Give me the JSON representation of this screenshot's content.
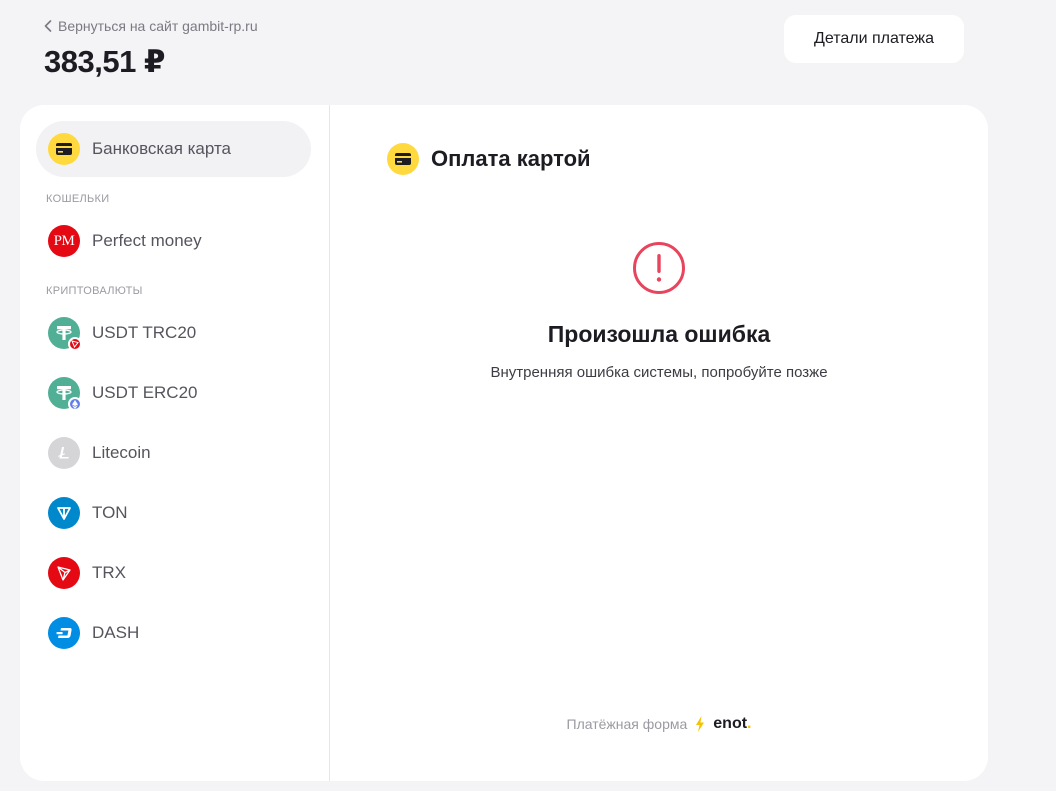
{
  "header": {
    "back_label": "Вернуться на сайт gambit-rp.ru",
    "amount": "383,51 ₽",
    "details_button": "Детали платежа"
  },
  "sidebar": {
    "active_method": {
      "label": "Банковская карта",
      "icon": "card-icon"
    },
    "groups": [
      {
        "label": "КОШЕЛЬКИ",
        "items": [
          {
            "label": "Perfect money",
            "icon": "perfect-money-icon",
            "icon_text": "PM"
          }
        ]
      },
      {
        "label": "КРИПТОВАЛЮТЫ",
        "items": [
          {
            "label": "USDT TRC20",
            "icon": "tether-trc20-icon"
          },
          {
            "label": "USDT ERC20",
            "icon": "tether-erc20-icon"
          },
          {
            "label": "Litecoin",
            "icon": "litecoin-icon"
          },
          {
            "label": "TON",
            "icon": "ton-icon"
          },
          {
            "label": "TRX",
            "icon": "tron-icon"
          },
          {
            "label": "DASH",
            "icon": "dash-icon"
          }
        ]
      }
    ]
  },
  "main": {
    "title": "Оплата картой",
    "error_title": "Произошла ошибка",
    "error_description": "Внутренняя ошибка системы, попробуйте позже",
    "footer_label": "Платёжная форма",
    "brand_name": "enot",
    "brand_dot": "."
  },
  "colors": {
    "accent_yellow": "#ffd93d",
    "error_red": "#e8455d",
    "tether_green": "#50af95",
    "tron_red": "#e50914",
    "ton_blue": "#0088cc",
    "dash_blue": "#008de4",
    "litecoin_gray": "#d5d5d8"
  }
}
